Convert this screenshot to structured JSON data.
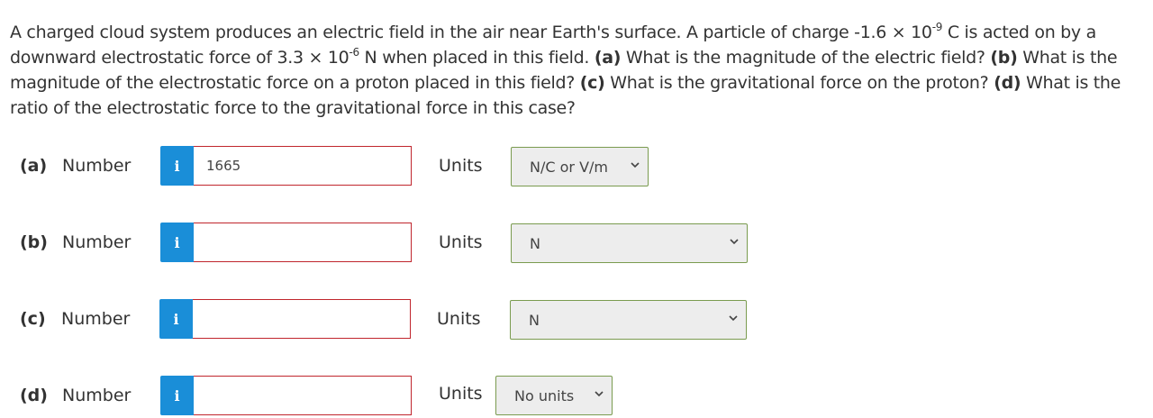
{
  "question": {
    "intro": "A charged cloud system produces an electric field in the air near Earth's surface. A particle of charge -1.6 × 10",
    "charge_exp": "-9",
    "after_charge": " C is acted on by a downward electrostatic force of 3.3 × 10",
    "force_exp": "-6",
    "after_force": " N when placed in this field. ",
    "a_tag": "(a)",
    "a_text": " What is the magnitude of the electric field? ",
    "b_tag": "(b)",
    "b_text": " What is the magnitude of the electrostatic force on a proton placed in this field? ",
    "c_tag": "(c)",
    "c_text": " What is the gravitational force on the proton? ",
    "d_tag": "(d)",
    "d_text": " What is the ratio of the electrostatic force to the gravitational force in this case?"
  },
  "parts": [
    {
      "label": "(a)",
      "number_label": "Number",
      "info_icon": "i",
      "value": "1665",
      "units_label": "Units",
      "units_selected": "N/C or V/m"
    },
    {
      "label": "(b)",
      "number_label": "Number",
      "info_icon": "i",
      "value": "",
      "units_label": "Units",
      "units_selected": "N"
    },
    {
      "label": "(c)",
      "number_label": "Number",
      "info_icon": "i",
      "value": "",
      "units_label": "Units",
      "units_selected": "N"
    },
    {
      "label": "(d)",
      "number_label": "Number",
      "info_icon": "i",
      "value": "",
      "units_label": "Units",
      "units_selected": "No units"
    }
  ],
  "colors": {
    "info_button": "#1a8ed8",
    "input_border_error": "#c0262d",
    "select_border": "#7a9b4f"
  }
}
